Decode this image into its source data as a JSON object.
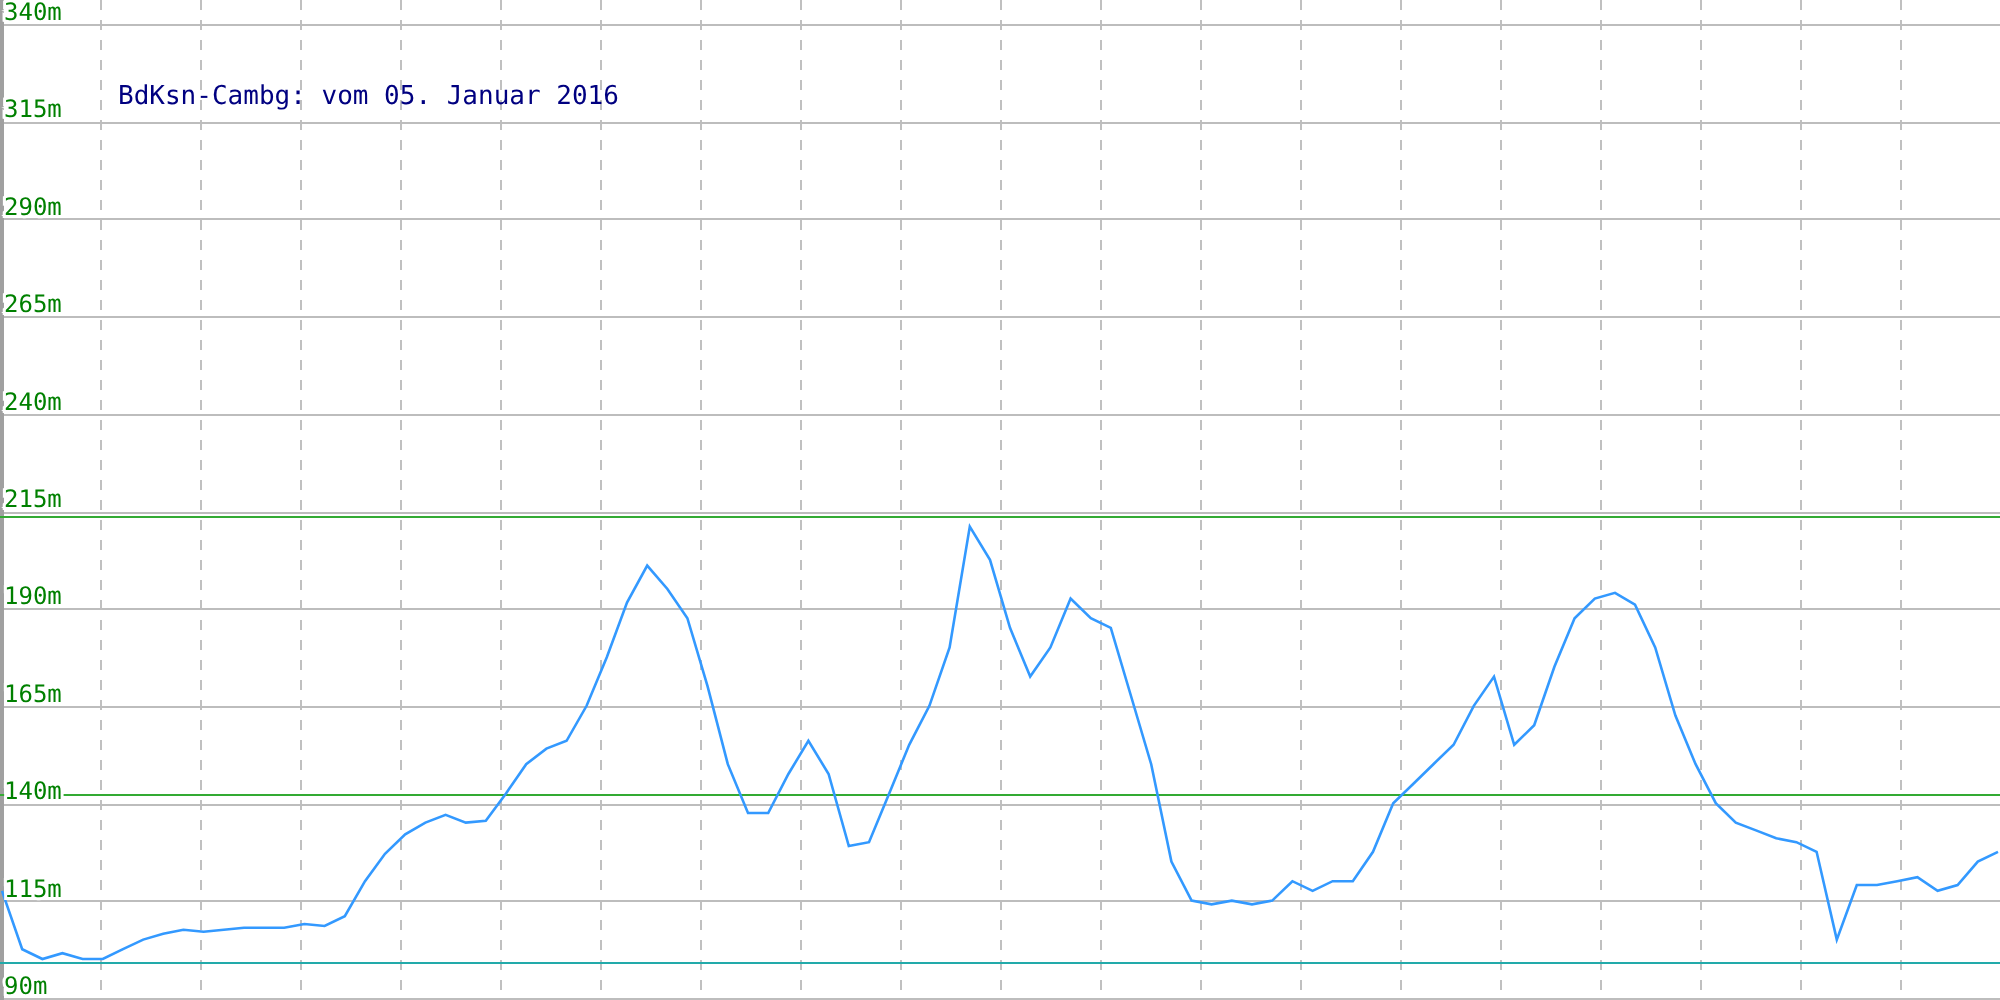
{
  "chart_data": {
    "type": "line",
    "title": "BdKsn-Cambg: vom 05. Januar 2016",
    "ylim": [
      90,
      340
    ],
    "yticks": [
      {
        "value": 90,
        "label": "90m"
      },
      {
        "value": 115,
        "label": "115m"
      },
      {
        "value": 140,
        "label": "140m"
      },
      {
        "value": 165,
        "label": "165m"
      },
      {
        "value": 190,
        "label": "190m"
      },
      {
        "value": 215,
        "label": "215m"
      },
      {
        "value": 240,
        "label": "240m"
      },
      {
        "value": 265,
        "label": "265m"
      },
      {
        "value": 290,
        "label": "290m"
      },
      {
        "value": 315,
        "label": "315m"
      },
      {
        "value": 340,
        "label": "340m"
      }
    ],
    "series": [
      {
        "color": "#3399ff",
        "values": [
          117.5,
          102.5,
          100,
          101.5,
          100,
          100,
          102.5,
          105,
          106.5,
          107.5,
          107,
          107.5,
          108,
          108,
          108,
          109,
          108.5,
          111,
          120,
          127,
          132,
          135,
          137,
          135,
          135.5,
          142.5,
          150,
          154,
          156,
          165,
          177.5,
          191.5,
          201,
          195,
          187.5,
          170,
          150,
          137.5,
          137.5,
          147.5,
          156,
          147.5,
          129,
          130,
          142.5,
          155,
          165,
          180,
          211,
          202.5,
          185,
          172.5,
          180,
          192.5,
          187.5,
          185,
          167.5,
          150,
          125,
          115,
          114,
          115,
          114,
          115,
          120,
          117.5,
          120,
          120,
          127.5,
          140,
          145,
          150,
          155,
          165,
          172.5,
          155,
          160,
          175,
          187.5,
          192.5,
          194,
          191,
          180,
          162.5,
          150,
          140,
          135,
          133,
          131,
          130,
          127.5,
          105,
          119,
          119,
          120,
          121,
          117.5,
          119,
          125,
          127.5
        ]
      }
    ],
    "ref_lines": [
      {
        "axis": "y",
        "value": 213.5,
        "color": "#33aa33"
      },
      {
        "axis": "y",
        "value": 142.5,
        "color": "#33aa33"
      },
      {
        "axis": "y",
        "value": 99,
        "color": "#22aaaa"
      }
    ],
    "grid": true
  }
}
